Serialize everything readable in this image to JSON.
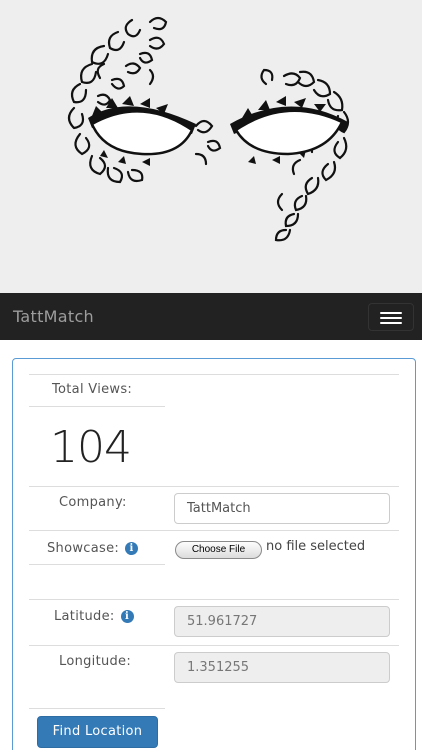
{
  "app": {
    "brand": "TattMatch"
  },
  "hero": {
    "image": "masquerade-mask-icon"
  },
  "navbar": {
    "menu_icon": "hamburger-icon"
  },
  "stats": {
    "total_views_label": "Total Views:",
    "total_views_value": "104"
  },
  "form": {
    "company_label": "Company:",
    "company_value": "TattMatch",
    "showcase_label": "Showcase:",
    "choose_file_label": "Choose File",
    "file_status": "no file selected",
    "latitude_label": "Latitude:",
    "latitude_value": "51.961727",
    "longitude_label": "Longitude:",
    "longitude_value": "1.351255",
    "info_glyph": "i",
    "find_location_label": "Find Location"
  },
  "colors": {
    "accent": "#337ab7",
    "navbar": "#222222",
    "panel_border": "#5b9bd5"
  }
}
